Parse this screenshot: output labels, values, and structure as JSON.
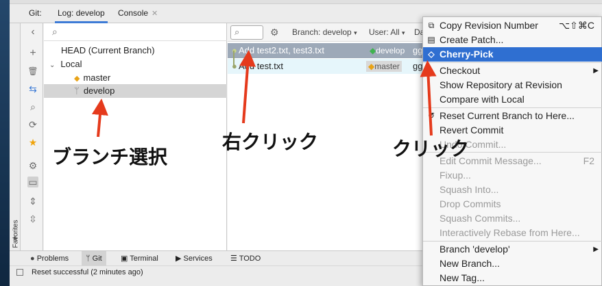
{
  "tabs": {
    "git_label": "Git:",
    "log_tab": "Log: develop",
    "console_tab": "Console"
  },
  "branches": {
    "head": "HEAD (Current Branch)",
    "local": "Local",
    "items": [
      "master",
      "develop"
    ]
  },
  "log": {
    "branch_filter": "Branch: develop",
    "user_filter": "User: All",
    "date_filter": "Da",
    "commits": [
      {
        "message": "Add test2.txt, test3.txt",
        "tag": "develop",
        "author": "gg"
      },
      {
        "message": "Add test.txt",
        "tag": "master",
        "author": "gg"
      }
    ]
  },
  "bottom_tools": [
    "Problems",
    "Git",
    "Terminal",
    "Services",
    "TODO"
  ],
  "status": "Reset successful (2 minutes ago)",
  "favorites": "Favorites",
  "menu": {
    "items": [
      {
        "label": "Copy Revision Number",
        "shortcut": "⌥⇧⌘C"
      },
      {
        "label": "Create Patch..."
      },
      {
        "label": "Cherry-Pick"
      },
      {
        "label": "Checkout"
      },
      {
        "label": "Show Repository at Revision"
      },
      {
        "label": "Compare with Local"
      },
      {
        "label": "Reset Current Branch to Here..."
      },
      {
        "label": "Revert Commit"
      },
      {
        "label": "Undo Commit..."
      },
      {
        "label": "Edit Commit Message...",
        "shortcut": "F2"
      },
      {
        "label": "Fixup..."
      },
      {
        "label": "Squash Into..."
      },
      {
        "label": "Drop Commits"
      },
      {
        "label": "Squash Commits..."
      },
      {
        "label": "Interactively Rebase from Here..."
      },
      {
        "label": "Branch 'develop'"
      },
      {
        "label": "New Branch..."
      },
      {
        "label": "New Tag..."
      }
    ]
  },
  "annotations": {
    "branch_select": "ブランチ選択",
    "right_click": "右クリック",
    "click": "クリック"
  },
  "colors": {
    "arrow": "#e53a1c",
    "highlight": "#2f6fd1",
    "accent_tab": "#3d7bd6"
  }
}
